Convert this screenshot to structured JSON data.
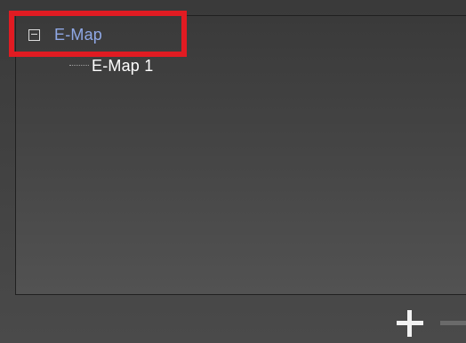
{
  "tree": {
    "root": {
      "label": "E-Map",
      "expanded": true,
      "children": [
        {
          "label": "E-Map 1"
        }
      ]
    }
  },
  "toolbar": {
    "add_icon": "plus-icon",
    "remove_icon": "minus-icon"
  },
  "colors": {
    "highlight": "#e11b22",
    "selected_text": "#8fa8e6"
  }
}
